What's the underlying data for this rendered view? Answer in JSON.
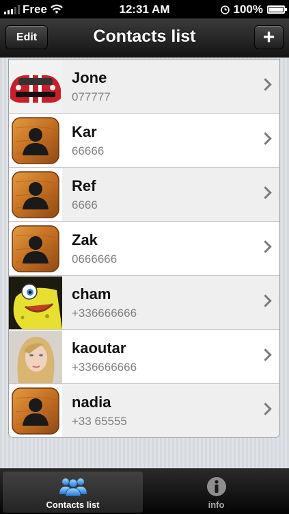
{
  "status": {
    "carrier": "Free",
    "time": "12:31 AM",
    "battery": "100%"
  },
  "nav": {
    "title": "Contacts list",
    "edit_label": "Edit",
    "add_label": "+"
  },
  "contacts": [
    {
      "name": "Jone",
      "phone": "077777",
      "avatar": "car-photo"
    },
    {
      "name": "Kar",
      "phone": "66666",
      "avatar": "default-person-icon"
    },
    {
      "name": "Ref",
      "phone": "6666",
      "avatar": "default-person-icon"
    },
    {
      "name": "Zak",
      "phone": "0666666",
      "avatar": "default-person-icon"
    },
    {
      "name": "cham",
      "phone": "+336666666",
      "avatar": "cartoon-photo"
    },
    {
      "name": "kaoutar",
      "phone": "+336666666",
      "avatar": "woman-photo"
    },
    {
      "name": "nadia",
      "phone": "+33 65555",
      "avatar": "default-person-icon"
    }
  ],
  "tabs": [
    {
      "label": "Contacts list",
      "icon": "people-icon",
      "selected": true
    },
    {
      "label": "info",
      "icon": "info-icon",
      "selected": false
    }
  ]
}
